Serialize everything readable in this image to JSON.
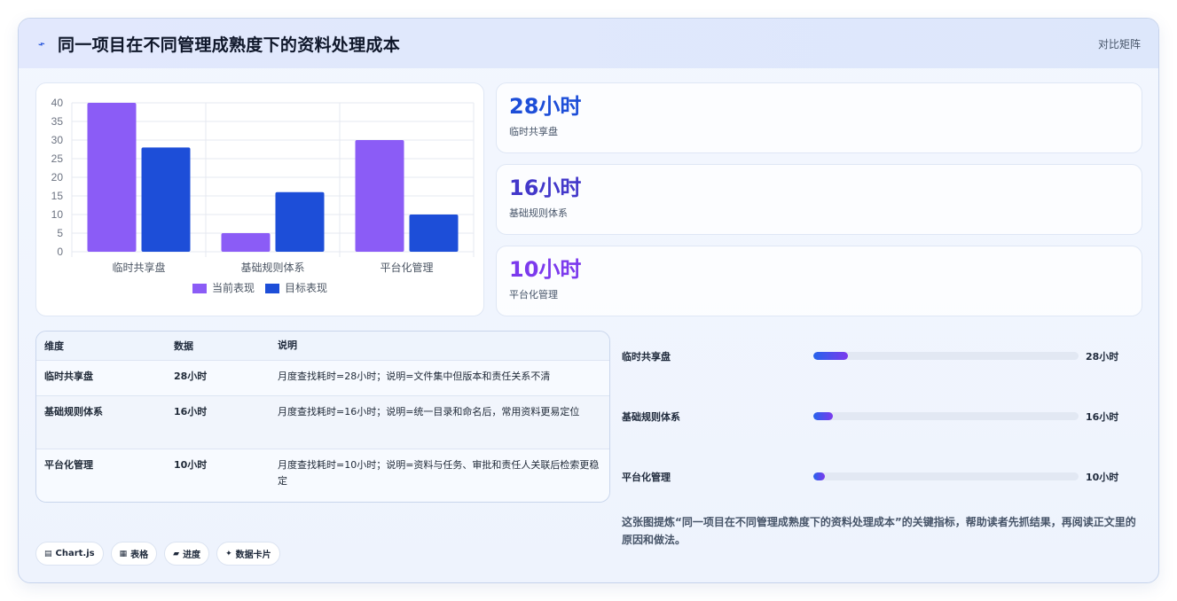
{
  "header": {
    "icon": "sparkline-icon",
    "title": "同一项目在不同管理成熟度下的资料处理成本",
    "link": "对比矩阵"
  },
  "chart_data": {
    "type": "bar",
    "categories": [
      "临时共享盘",
      "基础规则体系",
      "平台化管理"
    ],
    "series": [
      {
        "name": "当前表现",
        "values": [
          40,
          5,
          30
        ],
        "color": "#8b5cf6"
      },
      {
        "name": "目标表现",
        "values": [
          28,
          16,
          10
        ],
        "color": "#1d4ed8"
      }
    ],
    "yticks": [
      "0",
      "5",
      "10",
      "15",
      "20",
      "25",
      "30",
      "35",
      "40"
    ],
    "ylim": [
      0,
      40
    ],
    "legend": "bottom",
    "grid": true
  },
  "stats": [
    {
      "value": "28小时",
      "label": "临时共享盘",
      "color": "#1d4ed8"
    },
    {
      "value": "16小时",
      "label": "基础规则体系",
      "color": "#4338ca"
    },
    {
      "value": "10小时",
      "label": "平台化管理",
      "color": "#7c3aed"
    }
  ],
  "table": {
    "headers": [
      "维度",
      "数据",
      "说明"
    ],
    "rows": [
      {
        "dim": "临时共享盘",
        "data": "28小时",
        "desc": "月度查找耗时=28小时；说明=文件集中但版本和责任关系不清"
      },
      {
        "dim": "基础规则体系",
        "data": "16小时",
        "desc": "月度查找耗时=16小时；说明=统一目录和命名后，常用资料更易定位"
      },
      {
        "dim": "平台化管理",
        "data": "10小时",
        "desc": "月度查找耗时=10小时；说明=资料与任务、审批和责任人关联后检索更稳定"
      }
    ]
  },
  "progress": [
    {
      "label": "临时共享盘",
      "value": "28小时",
      "fraction": 0.13
    },
    {
      "label": "基础规则体系",
      "value": "16小时",
      "fraction": 0.075
    },
    {
      "label": "平台化管理",
      "value": "10小时",
      "fraction": 0.045
    }
  ],
  "caption": "这张图提炼“同一项目在不同管理成熟度下的资料处理成本”的关键指标，帮助读者先抓结果，再阅读正文里的原因和做法。",
  "badges": [
    {
      "icon": "chart-icon",
      "glyph": "▤",
      "label": "Chart.js"
    },
    {
      "icon": "table-icon",
      "glyph": "▦",
      "label": "表格"
    },
    {
      "icon": "progress-icon",
      "glyph": "▰",
      "label": "进度"
    },
    {
      "icon": "sparkle-icon",
      "glyph": "✦",
      "label": "数据卡片"
    }
  ]
}
